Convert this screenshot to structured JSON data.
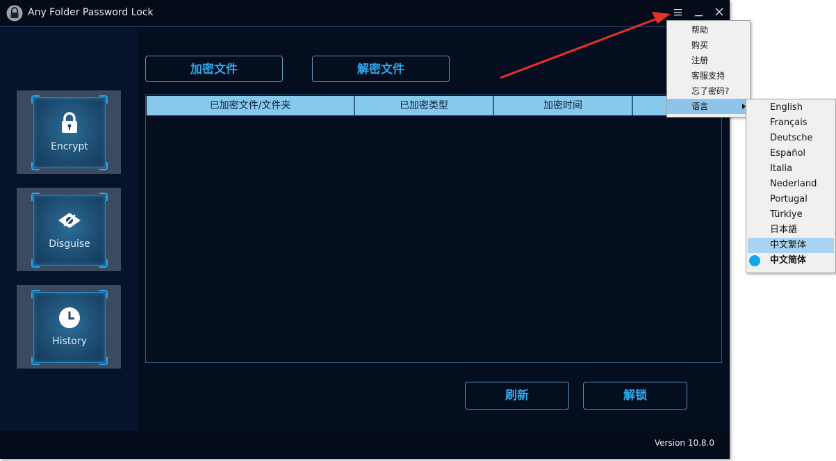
{
  "window": {
    "title": "Any Folder Password Lock",
    "menu_icon": "hamburger-icon",
    "minimize_icon": "minimize-icon",
    "close_icon": "close-icon"
  },
  "sidebar": {
    "items": [
      {
        "label": "Encrypt",
        "icon": "lock-icon"
      },
      {
        "label": "Disguise",
        "icon": "eye-disguise-icon"
      },
      {
        "label": "History",
        "icon": "clock-icon"
      }
    ]
  },
  "toolbar": {
    "encrypt_files": "加密文件",
    "decrypt_files": "解密文件"
  },
  "table": {
    "columns": [
      "已加密文件/文件夹",
      "已加密类型",
      "加密时间",
      ""
    ],
    "rows": []
  },
  "actions": {
    "refresh": "刷新",
    "unlock": "解锁"
  },
  "footer": {
    "version": "Version 10.8.0"
  },
  "main_menu": {
    "items": [
      "帮助",
      "购买",
      "注册",
      "客服支持",
      "忘了密码?",
      "语言"
    ],
    "highlighted": "语言"
  },
  "language_menu": {
    "items": [
      "English",
      "Français",
      "Deutsche",
      "Español",
      "Italia",
      "Nederland",
      "Portugal",
      "Türkiye",
      "日本語",
      "中文繁体",
      "中文简体"
    ],
    "hovered": "中文繁体",
    "selected": "中文简体"
  },
  "colors": {
    "accent": "#2fa8ec",
    "background": "#050e1f",
    "header": "#87c9ec",
    "arrow": "#e8302a"
  }
}
